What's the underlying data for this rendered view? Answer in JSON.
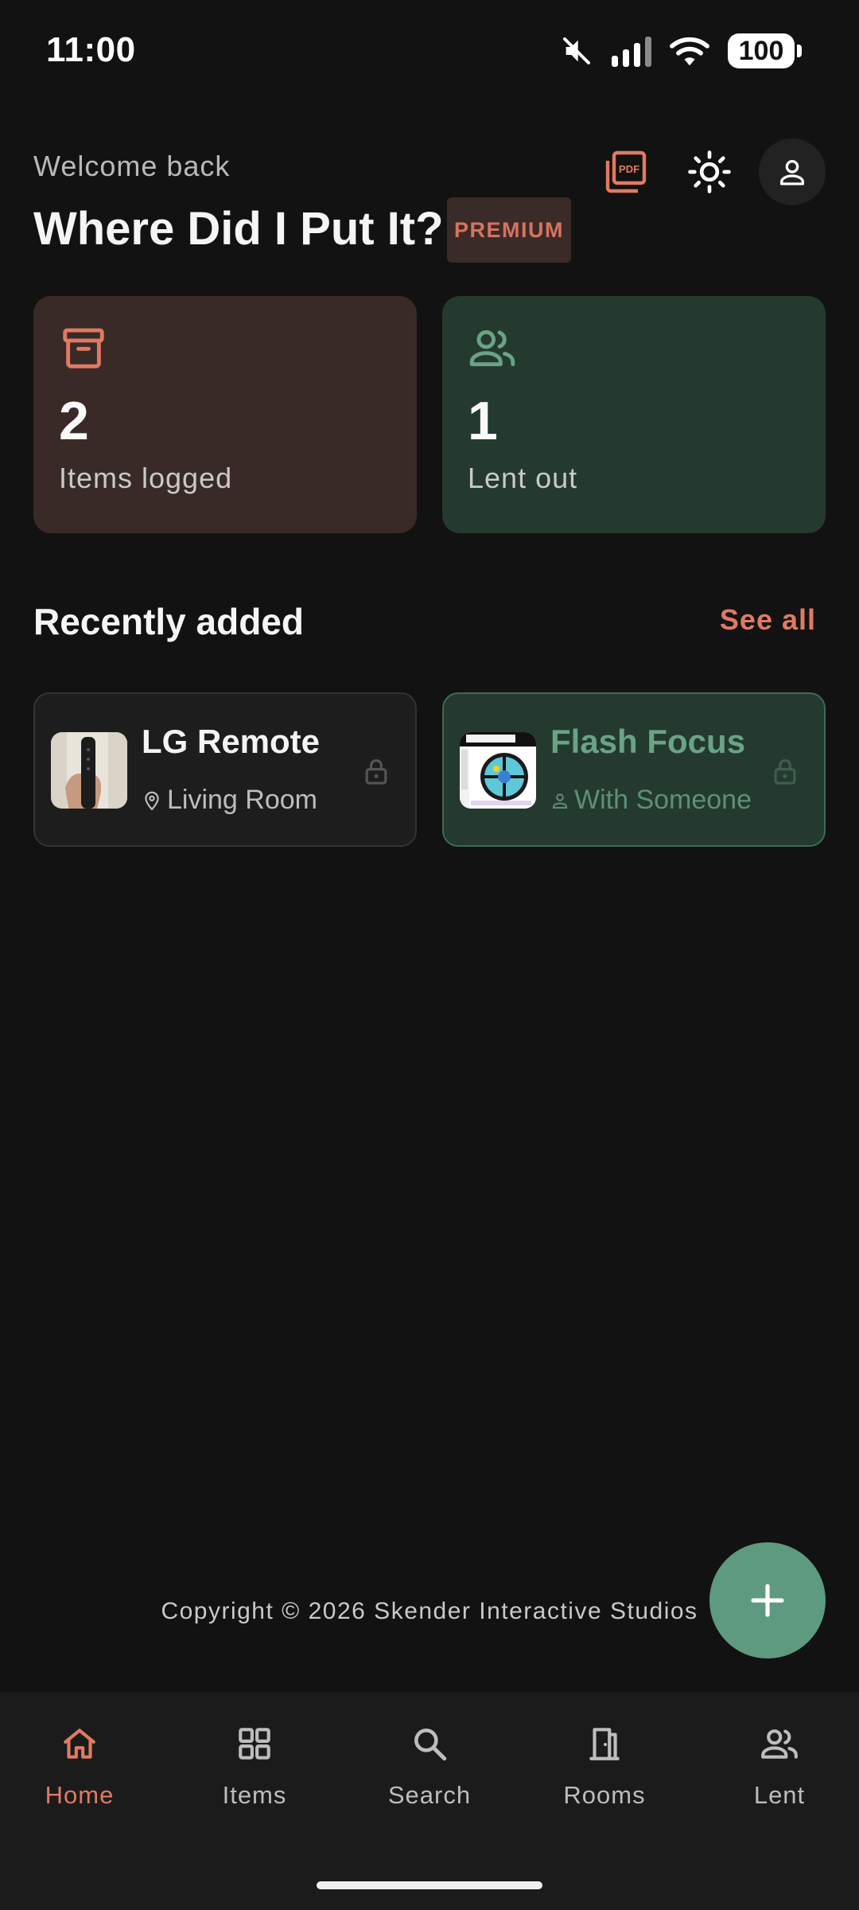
{
  "status_bar": {
    "time": "11:00",
    "battery": "100"
  },
  "header": {
    "welcome": "Welcome back",
    "title": "Where Did I Put It?",
    "badge": "PREMIUM",
    "pdf_icon_text": "PDF"
  },
  "stats": [
    {
      "value": "2",
      "label": "Items logged",
      "icon": "archive-icon"
    },
    {
      "value": "1",
      "label": "Lent out",
      "icon": "people-icon"
    }
  ],
  "recent": {
    "title": "Recently added",
    "see_all": "See all",
    "items": [
      {
        "name": "LG Remote",
        "location": "Living Room"
      },
      {
        "name": "Flash Focus",
        "location": "With Someone"
      }
    ]
  },
  "footer": {
    "copyright": "Copyright © 2026 Skender Interactive Studios"
  },
  "nav": {
    "items": [
      {
        "label": "Home",
        "active": true
      },
      {
        "label": "Items",
        "active": false
      },
      {
        "label": "Search",
        "active": false
      },
      {
        "label": "Rooms",
        "active": false
      },
      {
        "label": "Lent",
        "active": false
      }
    ]
  },
  "colors": {
    "background": "#121212",
    "accent": "#e07a62",
    "green": "#5e9a80"
  }
}
